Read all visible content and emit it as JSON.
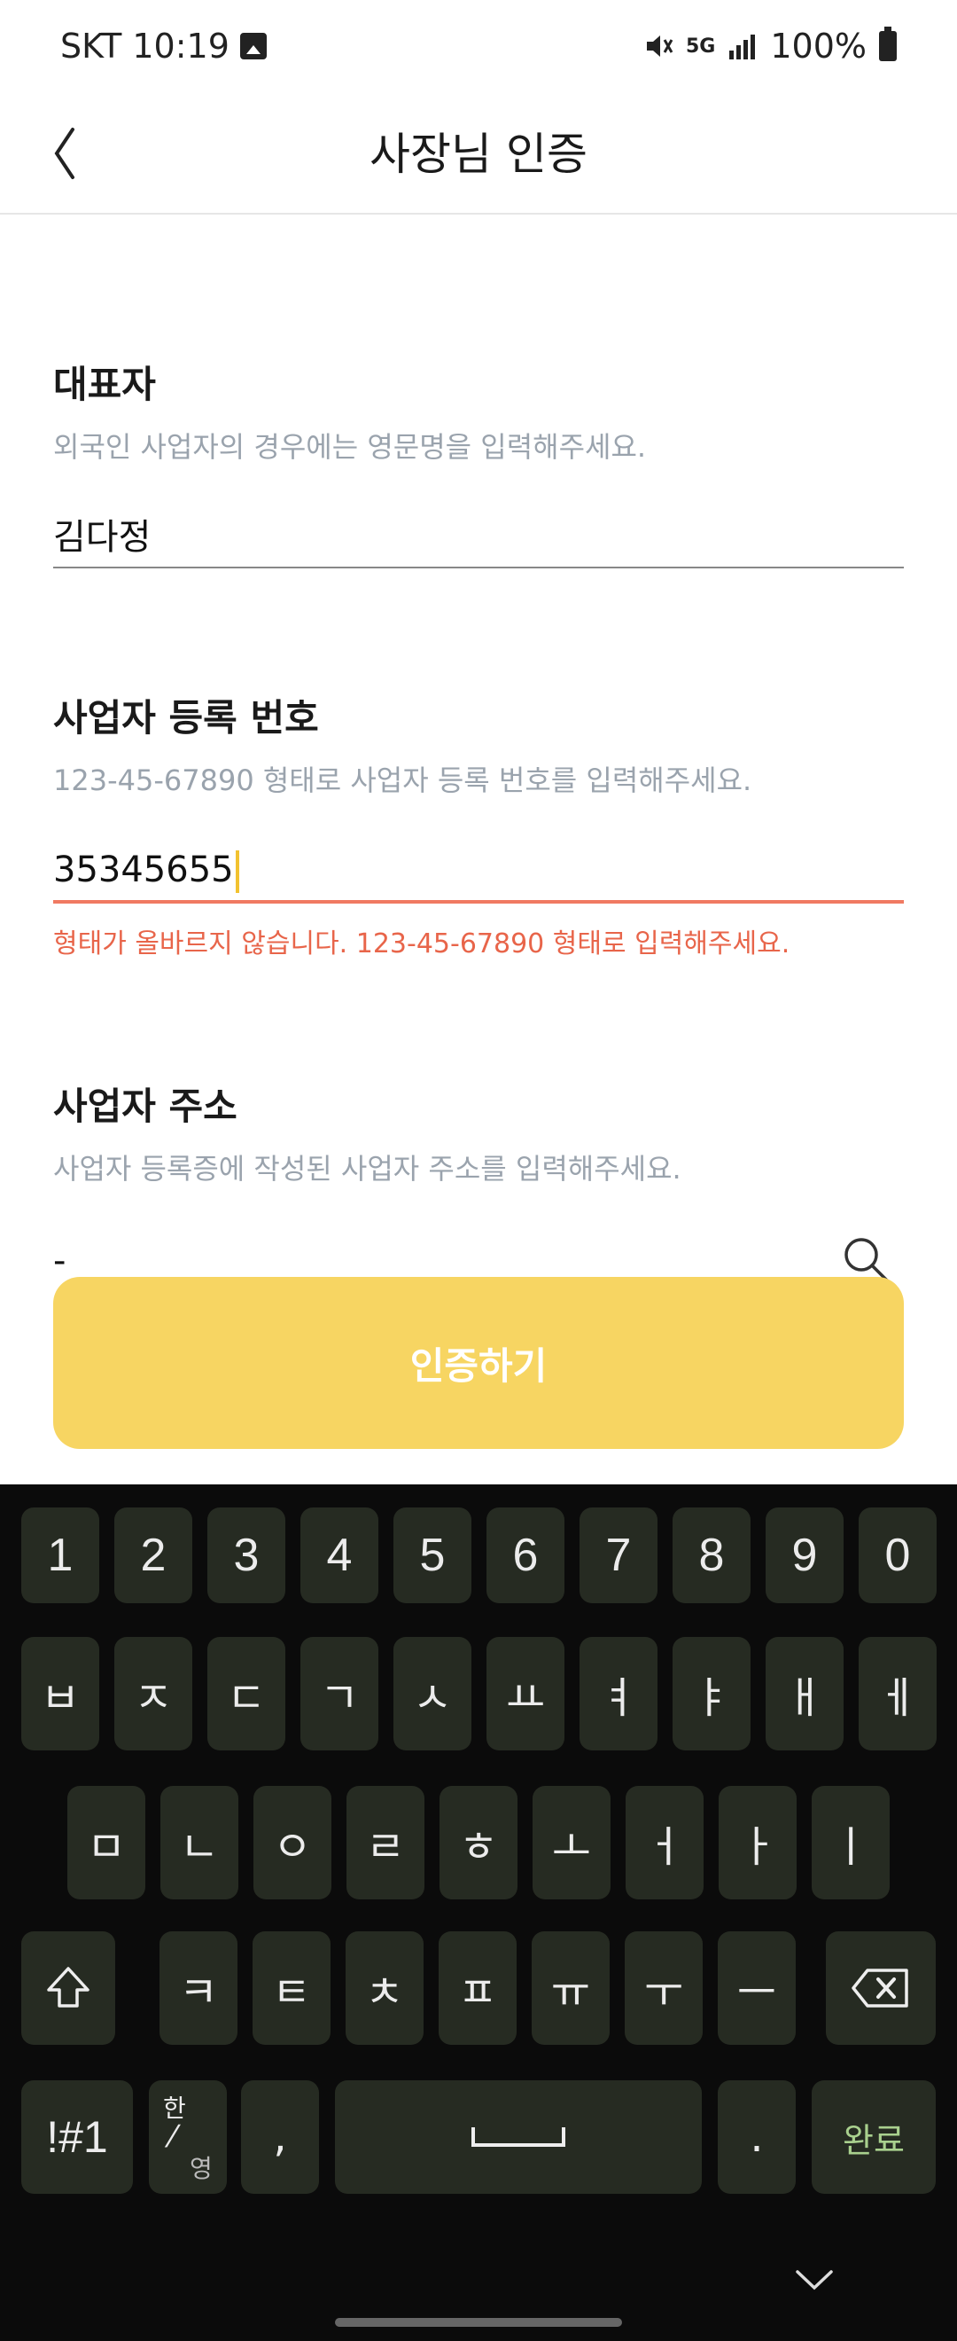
{
  "status_bar": {
    "carrier_time": "SKT 10:19",
    "network": "5G",
    "battery": "100%"
  },
  "header": {
    "title": "사장님 인증"
  },
  "owner": {
    "label": "대표자",
    "help": "외국인 사업자의 경우에는 영문명을 입력해주세요.",
    "value": "김다정"
  },
  "business_number": {
    "label": "사업자 등록 번호",
    "help": "123-45-67890 형태로 사업자 등록 번호를 입력해주세요.",
    "value": "35345655",
    "error": "형태가 올바르지 않습니다. 123-45-67890 형태로 입력해주세요."
  },
  "address": {
    "label": "사업자 주소",
    "help": "사업자 등록증에 작성된 사업자 주소를 입력해주세요.",
    "value": "-"
  },
  "submit_label": "인증하기",
  "keyboard": {
    "row1": [
      "1",
      "2",
      "3",
      "4",
      "5",
      "6",
      "7",
      "8",
      "9",
      "0"
    ],
    "row2": [
      "ㅂ",
      "ㅈ",
      "ㄷ",
      "ㄱ",
      "ㅅ",
      "ㅛ",
      "ㅕ",
      "ㅑ",
      "ㅐ",
      "ㅔ"
    ],
    "row3": [
      "ㅁ",
      "ㄴ",
      "ㅇ",
      "ㄹ",
      "ㅎ",
      "ㅗ",
      "ㅓ",
      "ㅏ",
      "ㅣ"
    ],
    "row4": [
      "ㅋ",
      "ㅌ",
      "ㅊ",
      "ㅍ",
      "ㅠ",
      "ㅜ",
      "ㅡ"
    ],
    "symbols_label": "!#1",
    "lang_top": "한",
    "lang_bottom": "영",
    "comma": ",",
    "period": ".",
    "done_label": "완료"
  },
  "colors": {
    "accent": "#f7d562",
    "error": "#e8654a",
    "keyboard_bg": "#0b0b0b",
    "key_bg": "#262b22"
  }
}
